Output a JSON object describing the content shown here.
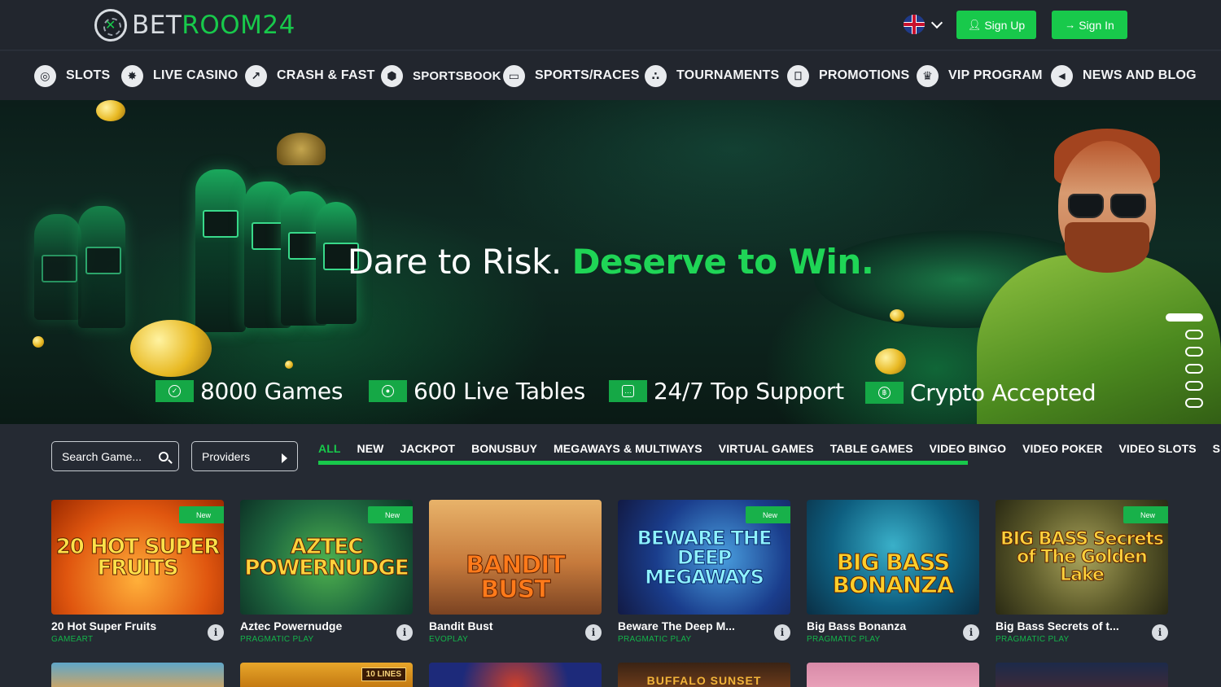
{
  "header": {
    "logo_prefix": "BET",
    "logo_suffix": "ROOM24",
    "signup_label": "Sign Up",
    "signin_label": "Sign In",
    "language": "English"
  },
  "nav": {
    "items": [
      {
        "label": "SLOTS",
        "icon": "slots-icon"
      },
      {
        "label": "LIVE CASINO",
        "icon": "live-casino-icon"
      },
      {
        "label": "CRASH & FAST",
        "icon": "rocket-icon"
      },
      {
        "label": "SPORTSBOOK",
        "icon": "soccer-ball-icon"
      },
      {
        "label": "SPORTS/RACES",
        "icon": "vr-headset-icon"
      },
      {
        "label": "TOURNAMENTS",
        "icon": "tournaments-icon"
      },
      {
        "label": "PROMOTIONS",
        "icon": "gift-icon"
      },
      {
        "label": "VIP PROGRAM",
        "icon": "crown-icon"
      },
      {
        "label": "NEWS AND BLOG",
        "icon": "megaphone-icon"
      }
    ]
  },
  "hero": {
    "title_plain": "Dare to Risk.",
    "title_accent": "Deserve to Win.",
    "features": [
      {
        "label": "8000 Games",
        "icon": "check-icon"
      },
      {
        "label": "600 Live Tables",
        "icon": "user-icon"
      },
      {
        "label": "24/7 Top Support",
        "icon": "chat-icon"
      },
      {
        "label": "Crypto Accepted",
        "icon": "bitcoin-icon"
      }
    ],
    "slides_total": 6,
    "slide_active": 1
  },
  "filters": {
    "search_placeholder": "Search Game...",
    "providers_label": "Providers",
    "categories": [
      "ALL",
      "NEW",
      "JACKPOT",
      "BONUSBUY",
      "MEGAWAYS & MULTIWAYS",
      "VIRTUAL GAMES",
      "TABLE GAMES",
      "VIDEO BINGO",
      "VIDEO POKER",
      "VIDEO SLOTS",
      "S"
    ],
    "active_category": "ALL"
  },
  "games": [
    {
      "name": "20 Hot Super Fruits",
      "provider": "GAMEART",
      "new": true,
      "thumb_text": "20 HOT SUPER FRUITS",
      "new_label": "New"
    },
    {
      "name": "Aztec Powernudge",
      "provider": "PRAGMATIC PLAY",
      "new": true,
      "thumb_text": "AZTEC POWERNUDGE",
      "new_label": "New"
    },
    {
      "name": "Bandit Bust",
      "provider": "EVOPLAY",
      "new": false,
      "thumb_text": "BANDIT BUST"
    },
    {
      "name": "Beware The Deep M...",
      "provider": "PRAGMATIC PLAY",
      "new": true,
      "thumb_text": "BEWARE THE DEEP MEGAWAYS",
      "new_label": "New"
    },
    {
      "name": "Big Bass Bonanza",
      "provider": "PRAGMATIC PLAY",
      "new": false,
      "thumb_text": "BIG BASS BONANZA"
    },
    {
      "name": "Big Bass Secrets of t...",
      "provider": "PRAGMATIC PLAY",
      "new": true,
      "thumb_text": "BIG BASS Secrets of The Golden Lake",
      "new_label": "New"
    }
  ],
  "row2_labels": [
    "10 LINES",
    "BUFFALO SUNSET"
  ],
  "colors": {
    "accent": "#18c94b",
    "background": "#252a33",
    "header": "#22262e"
  }
}
